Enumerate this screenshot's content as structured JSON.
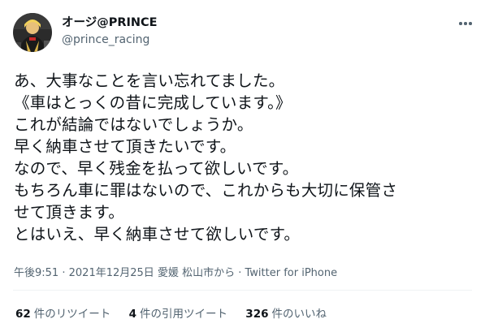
{
  "user": {
    "display_name": "オージ@PRINCE",
    "handle": "@prince_racing"
  },
  "tweet": {
    "lines": [
      "あ、大事なことを言い忘れてました。",
      "《車はとっくの昔に完成しています。》",
      "これが結論ではないでしょうか。",
      "早く納車させて頂きたいです。",
      "なので、早く残金を払って欲しいです。",
      "もちろん車に罪はないので、これからも大切に保管さ",
      "せて頂きます。",
      "とはいえ、早く納車させて欲しいです。"
    ]
  },
  "meta": {
    "time": "午後9:51",
    "separator": "·",
    "date": "2021年12月25日",
    "location": "愛媛 松山市から",
    "client": "Twitter for iPhone"
  },
  "stats": {
    "retweets_count": "62",
    "retweets_label": "件のリツイート",
    "quotes_count": "4",
    "quotes_label": "件の引用ツイート",
    "likes_count": "326",
    "likes_label": "件のいいね"
  },
  "icons": {
    "avatar": "avatar-image",
    "more": "more-options-icon"
  },
  "colors": {
    "text": "#0f1419",
    "secondary": "#536471",
    "divider": "#eff3f4"
  }
}
